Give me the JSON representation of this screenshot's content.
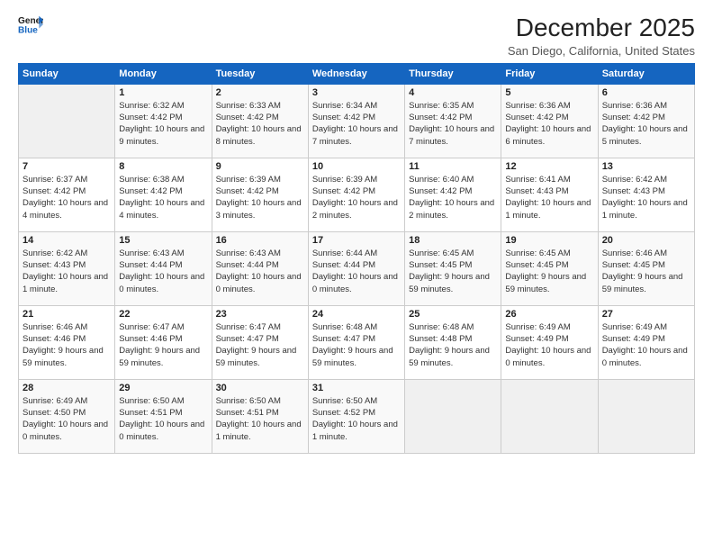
{
  "logo": {
    "text_general": "General",
    "text_blue": "Blue"
  },
  "header": {
    "title": "December 2025",
    "subtitle": "San Diego, California, United States"
  },
  "weekdays": [
    "Sunday",
    "Monday",
    "Tuesday",
    "Wednesday",
    "Thursday",
    "Friday",
    "Saturday"
  ],
  "rows": [
    [
      {
        "day": "",
        "empty": true
      },
      {
        "day": "1",
        "rise": "Sunrise: 6:32 AM",
        "set": "Sunset: 4:42 PM",
        "daylight": "Daylight: 10 hours and 9 minutes."
      },
      {
        "day": "2",
        "rise": "Sunrise: 6:33 AM",
        "set": "Sunset: 4:42 PM",
        "daylight": "Daylight: 10 hours and 8 minutes."
      },
      {
        "day": "3",
        "rise": "Sunrise: 6:34 AM",
        "set": "Sunset: 4:42 PM",
        "daylight": "Daylight: 10 hours and 7 minutes."
      },
      {
        "day": "4",
        "rise": "Sunrise: 6:35 AM",
        "set": "Sunset: 4:42 PM",
        "daylight": "Daylight: 10 hours and 7 minutes."
      },
      {
        "day": "5",
        "rise": "Sunrise: 6:36 AM",
        "set": "Sunset: 4:42 PM",
        "daylight": "Daylight: 10 hours and 6 minutes."
      },
      {
        "day": "6",
        "rise": "Sunrise: 6:36 AM",
        "set": "Sunset: 4:42 PM",
        "daylight": "Daylight: 10 hours and 5 minutes."
      }
    ],
    [
      {
        "day": "7",
        "rise": "Sunrise: 6:37 AM",
        "set": "Sunset: 4:42 PM",
        "daylight": "Daylight: 10 hours and 4 minutes."
      },
      {
        "day": "8",
        "rise": "Sunrise: 6:38 AM",
        "set": "Sunset: 4:42 PM",
        "daylight": "Daylight: 10 hours and 4 minutes."
      },
      {
        "day": "9",
        "rise": "Sunrise: 6:39 AM",
        "set": "Sunset: 4:42 PM",
        "daylight": "Daylight: 10 hours and 3 minutes."
      },
      {
        "day": "10",
        "rise": "Sunrise: 6:39 AM",
        "set": "Sunset: 4:42 PM",
        "daylight": "Daylight: 10 hours and 2 minutes."
      },
      {
        "day": "11",
        "rise": "Sunrise: 6:40 AM",
        "set": "Sunset: 4:42 PM",
        "daylight": "Daylight: 10 hours and 2 minutes."
      },
      {
        "day": "12",
        "rise": "Sunrise: 6:41 AM",
        "set": "Sunset: 4:43 PM",
        "daylight": "Daylight: 10 hours and 1 minute."
      },
      {
        "day": "13",
        "rise": "Sunrise: 6:42 AM",
        "set": "Sunset: 4:43 PM",
        "daylight": "Daylight: 10 hours and 1 minute."
      }
    ],
    [
      {
        "day": "14",
        "rise": "Sunrise: 6:42 AM",
        "set": "Sunset: 4:43 PM",
        "daylight": "Daylight: 10 hours and 1 minute."
      },
      {
        "day": "15",
        "rise": "Sunrise: 6:43 AM",
        "set": "Sunset: 4:44 PM",
        "daylight": "Daylight: 10 hours and 0 minutes."
      },
      {
        "day": "16",
        "rise": "Sunrise: 6:43 AM",
        "set": "Sunset: 4:44 PM",
        "daylight": "Daylight: 10 hours and 0 minutes."
      },
      {
        "day": "17",
        "rise": "Sunrise: 6:44 AM",
        "set": "Sunset: 4:44 PM",
        "daylight": "Daylight: 10 hours and 0 minutes."
      },
      {
        "day": "18",
        "rise": "Sunrise: 6:45 AM",
        "set": "Sunset: 4:45 PM",
        "daylight": "Daylight: 9 hours and 59 minutes."
      },
      {
        "day": "19",
        "rise": "Sunrise: 6:45 AM",
        "set": "Sunset: 4:45 PM",
        "daylight": "Daylight: 9 hours and 59 minutes."
      },
      {
        "day": "20",
        "rise": "Sunrise: 6:46 AM",
        "set": "Sunset: 4:45 PM",
        "daylight": "Daylight: 9 hours and 59 minutes."
      }
    ],
    [
      {
        "day": "21",
        "rise": "Sunrise: 6:46 AM",
        "set": "Sunset: 4:46 PM",
        "daylight": "Daylight: 9 hours and 59 minutes."
      },
      {
        "day": "22",
        "rise": "Sunrise: 6:47 AM",
        "set": "Sunset: 4:46 PM",
        "daylight": "Daylight: 9 hours and 59 minutes."
      },
      {
        "day": "23",
        "rise": "Sunrise: 6:47 AM",
        "set": "Sunset: 4:47 PM",
        "daylight": "Daylight: 9 hours and 59 minutes."
      },
      {
        "day": "24",
        "rise": "Sunrise: 6:48 AM",
        "set": "Sunset: 4:47 PM",
        "daylight": "Daylight: 9 hours and 59 minutes."
      },
      {
        "day": "25",
        "rise": "Sunrise: 6:48 AM",
        "set": "Sunset: 4:48 PM",
        "daylight": "Daylight: 9 hours and 59 minutes."
      },
      {
        "day": "26",
        "rise": "Sunrise: 6:49 AM",
        "set": "Sunset: 4:49 PM",
        "daylight": "Daylight: 10 hours and 0 minutes."
      },
      {
        "day": "27",
        "rise": "Sunrise: 6:49 AM",
        "set": "Sunset: 4:49 PM",
        "daylight": "Daylight: 10 hours and 0 minutes."
      }
    ],
    [
      {
        "day": "28",
        "rise": "Sunrise: 6:49 AM",
        "set": "Sunset: 4:50 PM",
        "daylight": "Daylight: 10 hours and 0 minutes."
      },
      {
        "day": "29",
        "rise": "Sunrise: 6:50 AM",
        "set": "Sunset: 4:51 PM",
        "daylight": "Daylight: 10 hours and 0 minutes."
      },
      {
        "day": "30",
        "rise": "Sunrise: 6:50 AM",
        "set": "Sunset: 4:51 PM",
        "daylight": "Daylight: 10 hours and 1 minute."
      },
      {
        "day": "31",
        "rise": "Sunrise: 6:50 AM",
        "set": "Sunset: 4:52 PM",
        "daylight": "Daylight: 10 hours and 1 minute."
      },
      {
        "day": "",
        "empty": true
      },
      {
        "day": "",
        "empty": true
      },
      {
        "day": "",
        "empty": true
      }
    ]
  ]
}
